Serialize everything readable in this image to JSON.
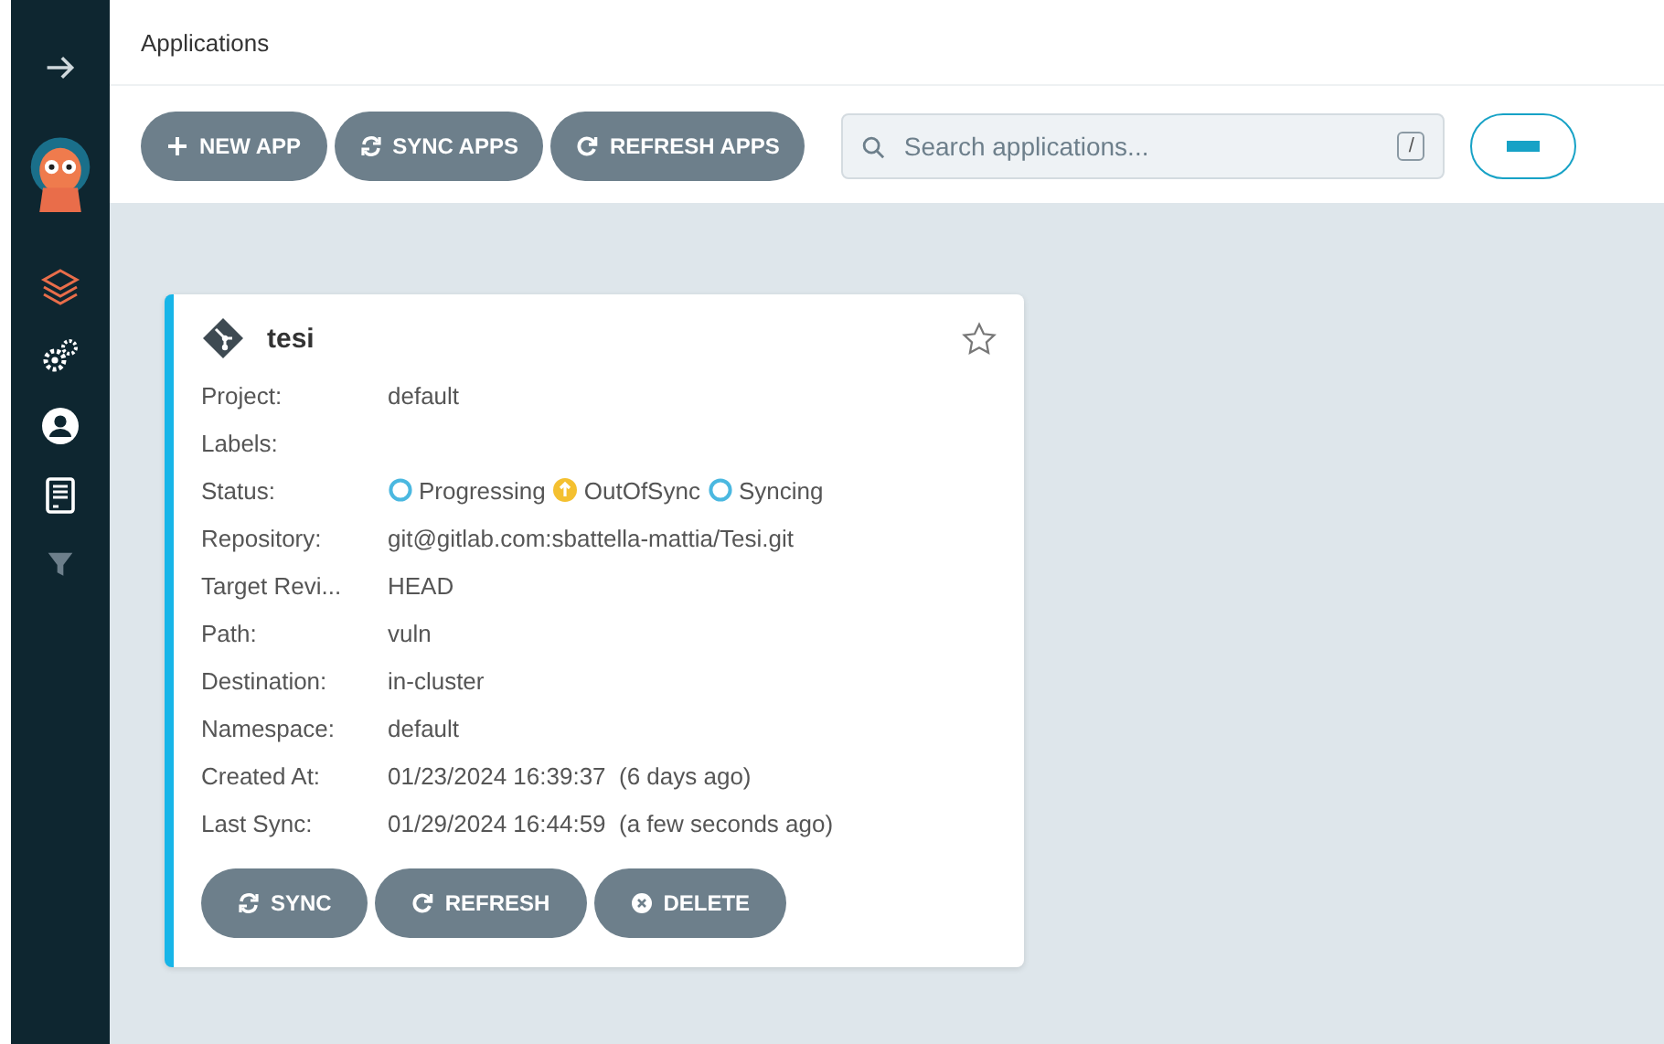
{
  "page_title": "Applications",
  "sidebar": {
    "items": [
      {
        "kind": "layers",
        "selected": true
      },
      {
        "kind": "gears",
        "selected": false
      },
      {
        "kind": "user",
        "selected": false
      },
      {
        "kind": "docs",
        "selected": false
      },
      {
        "kind": "filter",
        "selected": false
      }
    ]
  },
  "toolbar": {
    "buttons": [
      {
        "kind": "plus",
        "label": "NEW APP"
      },
      {
        "kind": "sync",
        "label": "SYNC APPS"
      },
      {
        "kind": "refresh",
        "label": "REFRESH APPS"
      }
    ],
    "search": {
      "placeholder": "Search applications...",
      "shortcut": "/"
    }
  },
  "app_card": {
    "name": "tesi",
    "favorite": false,
    "fields": [
      {
        "label": "Project:",
        "value": "default"
      },
      {
        "label": "Labels:"
      },
      {
        "label": "Status:",
        "statuses": [
          {
            "kind": "progressing",
            "text": "Progressing"
          },
          {
            "kind": "outofsync",
            "text": "OutOfSync"
          },
          {
            "kind": "syncing",
            "text": "Syncing"
          }
        ]
      },
      {
        "label": "Repository:",
        "value": "git@gitlab.com:sbattella-mattia/Tesi.git"
      },
      {
        "label": "Target Revi...",
        "value": "HEAD"
      },
      {
        "label": "Path:",
        "value": "vuln"
      },
      {
        "label": "Destination:",
        "value": "in-cluster"
      },
      {
        "label": "Namespace:",
        "value": "default"
      },
      {
        "label": "Created At:",
        "value": "01/23/2024 16:39:37  (6 days ago)"
      },
      {
        "label": "Last Sync:",
        "value": "01/29/2024 16:44:59  (a few seconds ago)"
      }
    ],
    "buttons": [
      {
        "kind": "sync",
        "label": "SYNC"
      },
      {
        "kind": "refresh",
        "label": "REFRESH"
      },
      {
        "kind": "delete",
        "label": "DELETE"
      }
    ]
  }
}
